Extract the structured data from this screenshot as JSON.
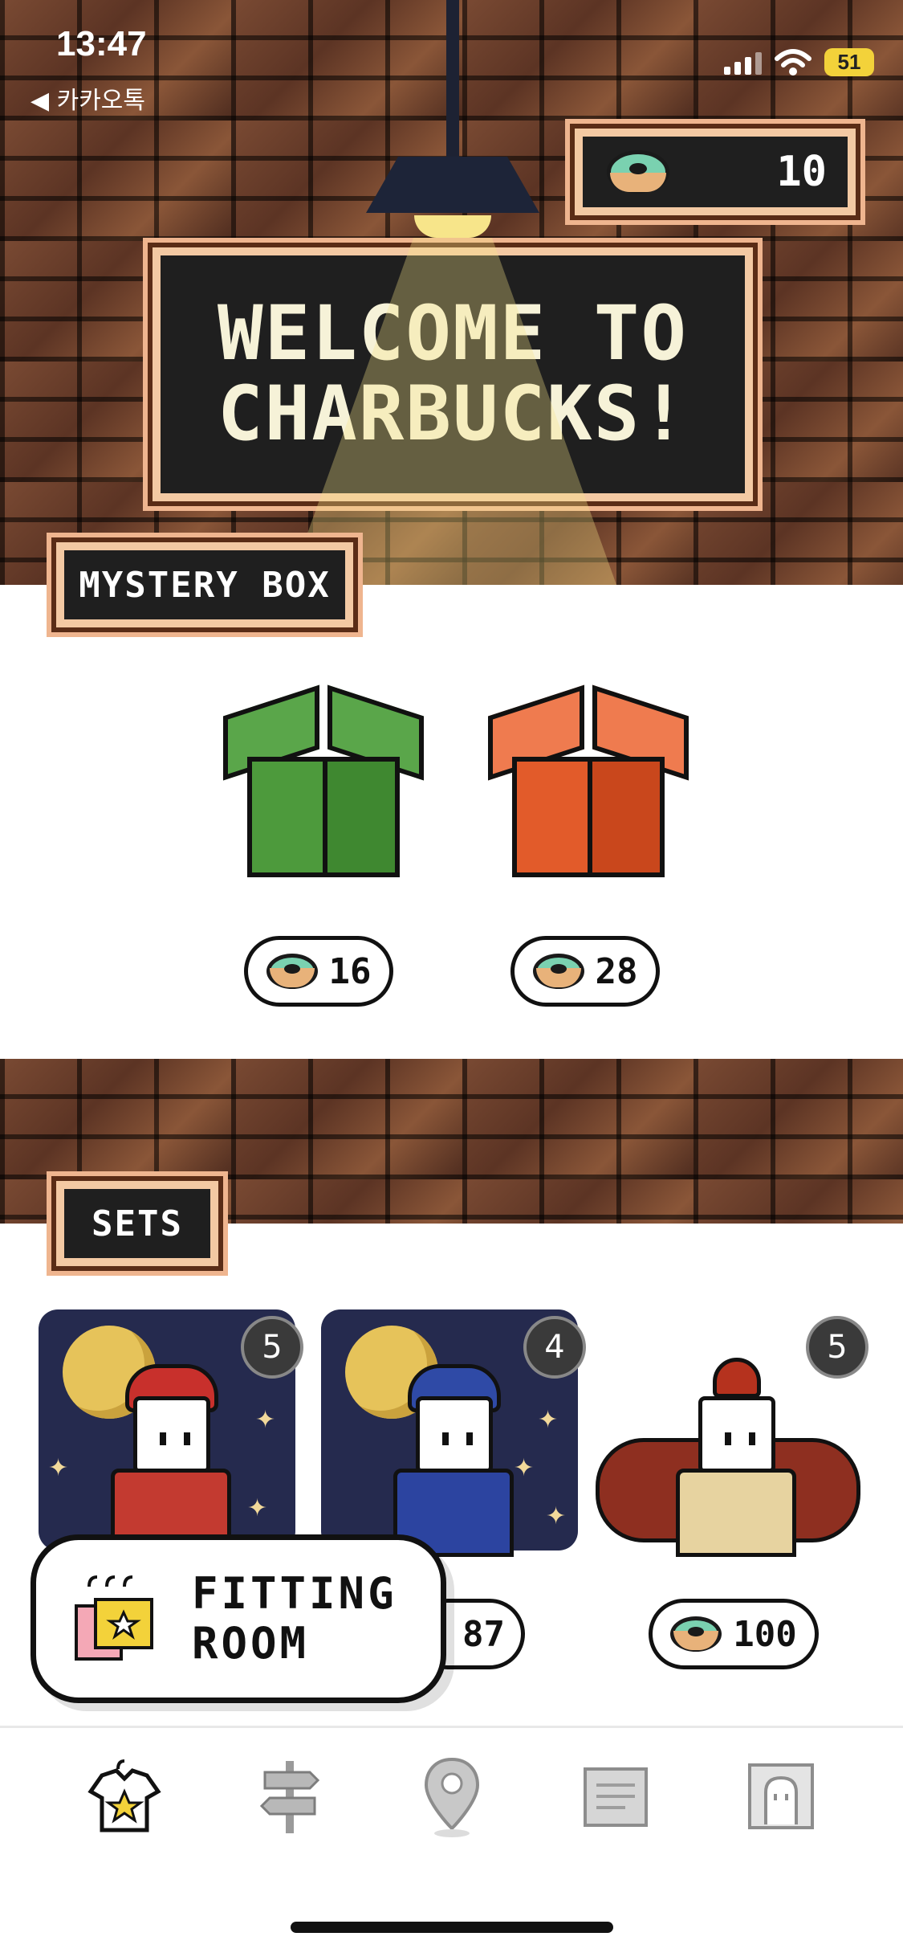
{
  "status_bar": {
    "time": "13:47",
    "back_label": "◀ 카카오톡",
    "battery": "51"
  },
  "header": {
    "currency_count": "10",
    "currency_icon": "donut-icon",
    "welcome_line1": "WELCOME TO",
    "welcome_line2": "CHARBUCKS!"
  },
  "mystery_box": {
    "label": "MYSTERY BOX",
    "boxes": [
      {
        "name": "green-box",
        "color": "#4d9a3c",
        "price": "16"
      },
      {
        "name": "orange-box",
        "color": "#e25b2a",
        "price": "28"
      }
    ]
  },
  "sets": {
    "label": "SETS",
    "items": [
      {
        "count": "5",
        "price": ""
      },
      {
        "count": "4",
        "price": "87"
      },
      {
        "count": "5",
        "price": "100"
      }
    ]
  },
  "fitting_room": {
    "line1": "FITTING",
    "line2": "ROOM"
  },
  "tab_bar": {
    "tabs": [
      {
        "icon": "tshirt-star-icon",
        "active": true
      },
      {
        "icon": "signpost-icon",
        "active": false
      },
      {
        "icon": "map-pin-icon",
        "active": false
      },
      {
        "icon": "scroll-map-icon",
        "active": false
      },
      {
        "icon": "profile-frame-icon",
        "active": false
      }
    ]
  },
  "colors": {
    "frame_border": "#f3c9a3",
    "sign_background": "#1f1f1f",
    "donut_icing": "#7ad1b0",
    "battery": "#f3d23a"
  }
}
